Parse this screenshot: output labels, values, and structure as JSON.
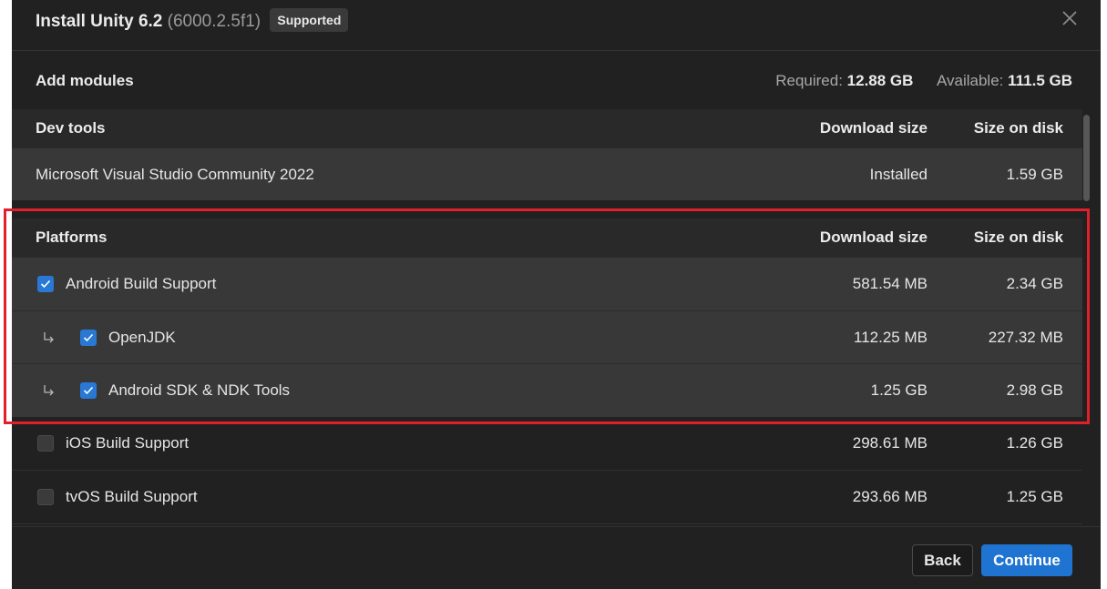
{
  "dialog": {
    "title_main": "Install Unity 6.2",
    "title_version": "(6000.2.5f1)",
    "badge": "Supported"
  },
  "add_modules": {
    "label": "Add modules",
    "required_label": "Required:",
    "required_value": "12.88 GB",
    "available_label": "Available:",
    "available_value": "111.5 GB"
  },
  "dev_tools": {
    "header": "Dev tools",
    "col_download": "Download size",
    "col_disk": "Size on disk",
    "items": [
      {
        "name": "Microsoft Visual Studio Community 2022",
        "download": "Installed",
        "disk": "1.59 GB"
      }
    ]
  },
  "platforms": {
    "header": "Platforms",
    "col_download": "Download size",
    "col_disk": "Size on disk",
    "items": [
      {
        "name": "Android Build Support",
        "download": "581.54 MB",
        "disk": "2.34 GB",
        "checked": true
      },
      {
        "name": "OpenJDK",
        "download": "112.25 MB",
        "disk": "227.32 MB",
        "checked": true
      },
      {
        "name": "Android SDK & NDK Tools",
        "download": "1.25 GB",
        "disk": "2.98 GB",
        "checked": true
      },
      {
        "name": "iOS Build Support",
        "download": "298.61 MB",
        "disk": "1.26 GB",
        "checked": false
      },
      {
        "name": "tvOS Build Support",
        "download": "293.66 MB",
        "disk": "1.25 GB",
        "checked": false
      }
    ]
  },
  "footer": {
    "back_label": "Back",
    "continue_label": "Continue"
  },
  "colors": {
    "accent": "#2978d6",
    "highlight": "#e0202a",
    "background": "#212121"
  },
  "icons": [
    "close-icon",
    "check-icon",
    "sub-item-arrow-icon"
  ]
}
